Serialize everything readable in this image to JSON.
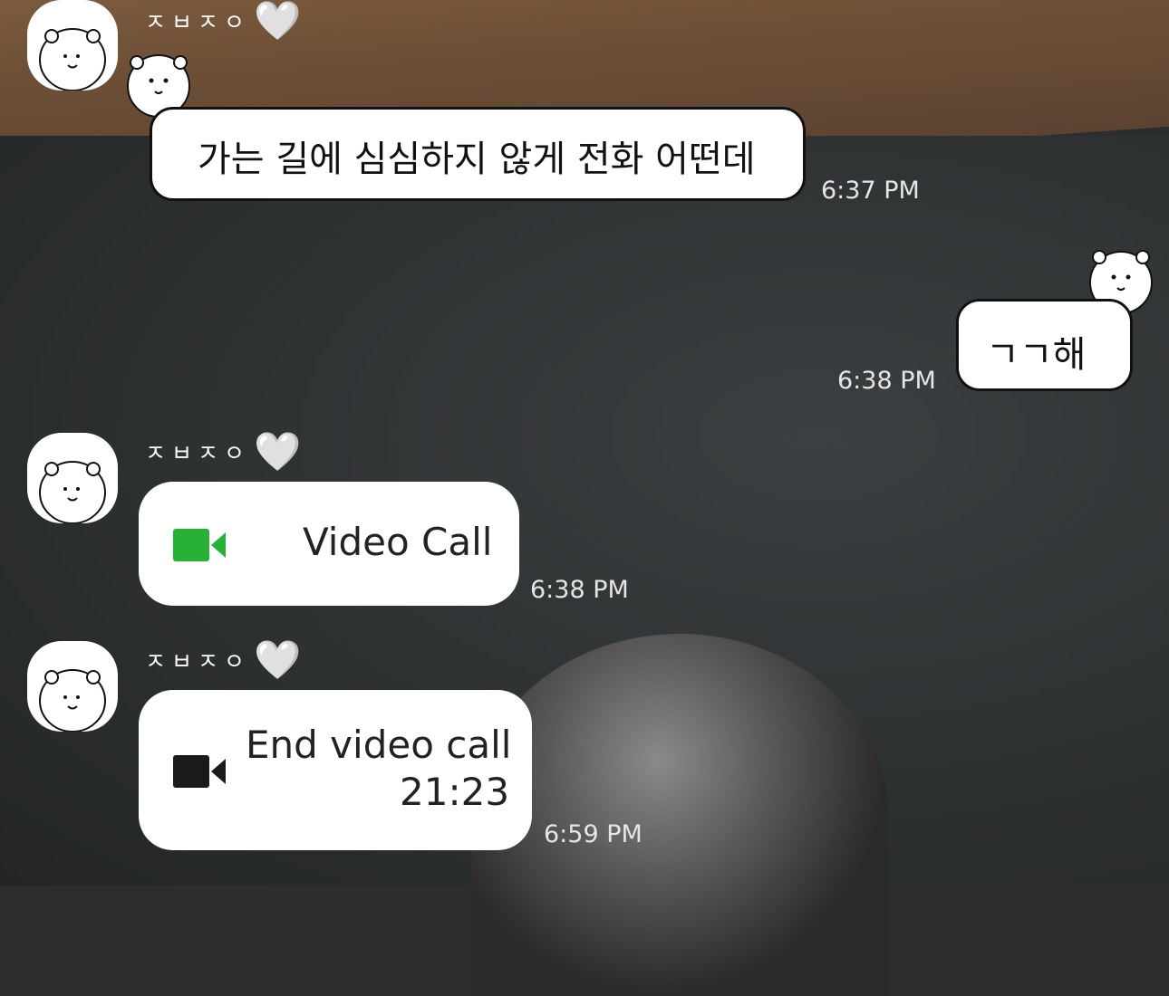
{
  "messages": [
    {
      "sender": "ㅈㅂㅈㅇ",
      "heart": "🤍",
      "text": "가는 길에 심심하지 않게 전화 어떤데",
      "time": "6:37 PM"
    },
    {
      "text": "ㄱㄱ해",
      "time": "6:38 PM"
    },
    {
      "sender": "ㅈㅂㅈㅇ",
      "heart": "🤍",
      "call_label": "Video Call",
      "time": "6:38 PM"
    },
    {
      "sender": "ㅈㅂㅈㅇ",
      "heart": "🤍",
      "call_label": "End video call",
      "duration": "21:23",
      "time": "6:59 PM"
    }
  ],
  "colors": {
    "video_call_icon": "#27b137",
    "end_call_icon": "#1a1a1a",
    "bubble": "#ffffff",
    "timestamp": "#e6e6e6"
  },
  "icons": {
    "avatar": "bear-avatar-icon",
    "video_call": "video-camera-icon",
    "end_call": "video-camera-icon"
  }
}
